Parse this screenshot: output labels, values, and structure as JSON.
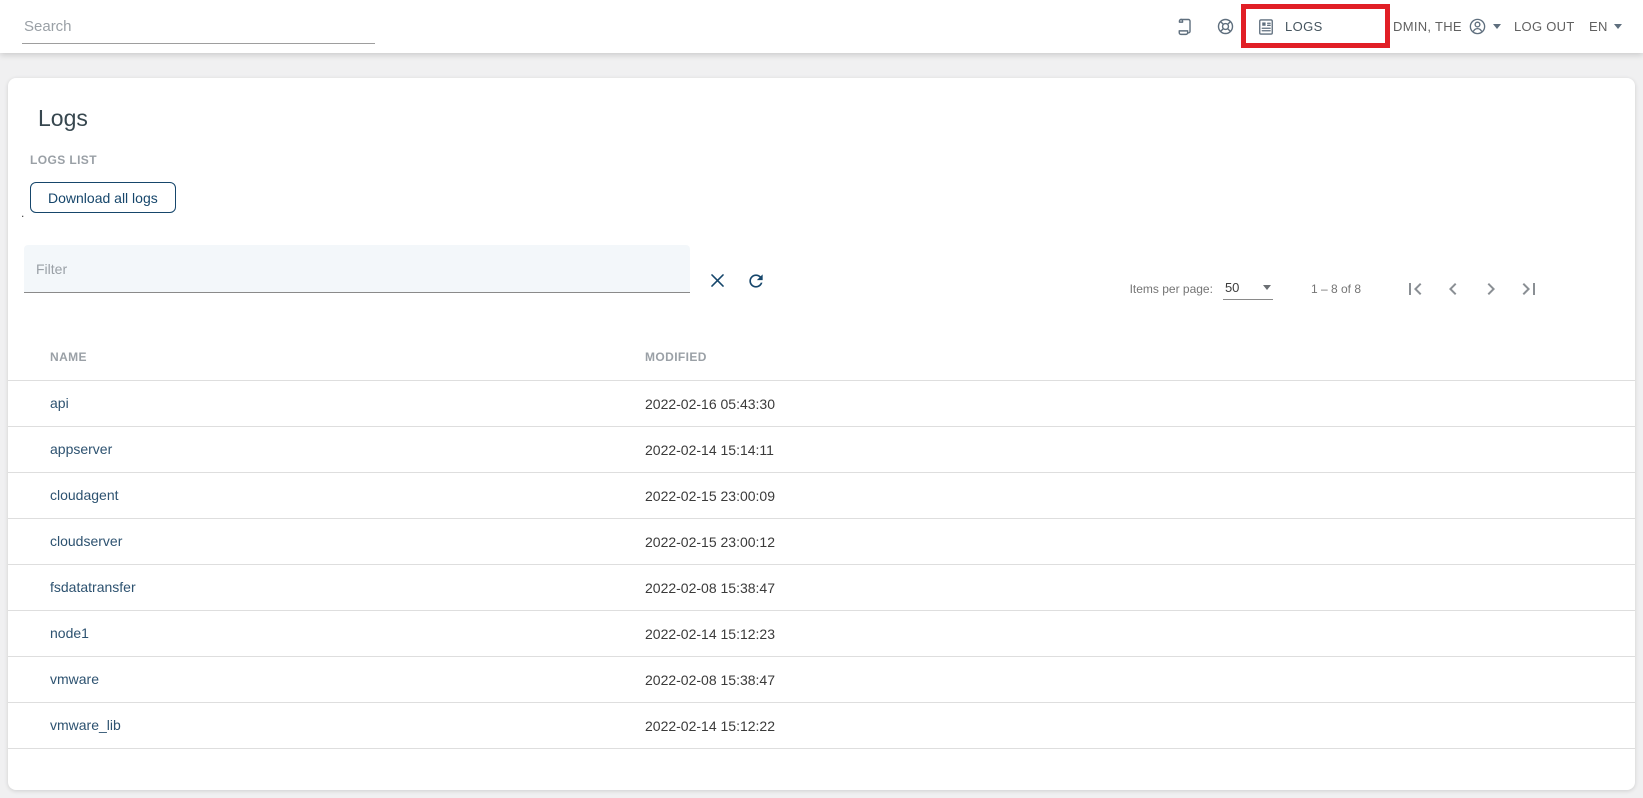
{
  "header": {
    "search": {
      "placeholder": "Search"
    },
    "actions": {
      "logs_label": "LOGS",
      "user_label": "DMIN, THE",
      "logout_label": "LOG OUT",
      "language_label": "EN"
    }
  },
  "page": {
    "title": "Logs",
    "section_label": "LOGS LIST",
    "download_button": "Download all logs",
    "stray_dot": "."
  },
  "filter": {
    "placeholder": "Filter"
  },
  "paginator": {
    "items_per_page_label": "Items per page:",
    "page_size": "50",
    "range_label": "1 – 8 of 8"
  },
  "table": {
    "columns": [
      "NAME",
      "MODIFIED"
    ],
    "rows": [
      {
        "name": "api",
        "modified": "2022-02-16 05:43:30"
      },
      {
        "name": "appserver",
        "modified": "2022-02-14 15:14:11"
      },
      {
        "name": "cloudagent",
        "modified": "2022-02-15 23:00:09"
      },
      {
        "name": "cloudserver",
        "modified": "2022-02-15 23:00:12"
      },
      {
        "name": "fsdatatransfer",
        "modified": "2022-02-08 15:38:47"
      },
      {
        "name": "node1",
        "modified": "2022-02-14 15:12:23"
      },
      {
        "name": "vmware",
        "modified": "2022-02-08 15:38:47"
      },
      {
        "name": "vmware_lib",
        "modified": "2022-02-14 15:12:22"
      }
    ]
  },
  "colors": {
    "accent_navy": "#16466b",
    "highlight_red": "#e11f26",
    "link": "#2d5270"
  }
}
